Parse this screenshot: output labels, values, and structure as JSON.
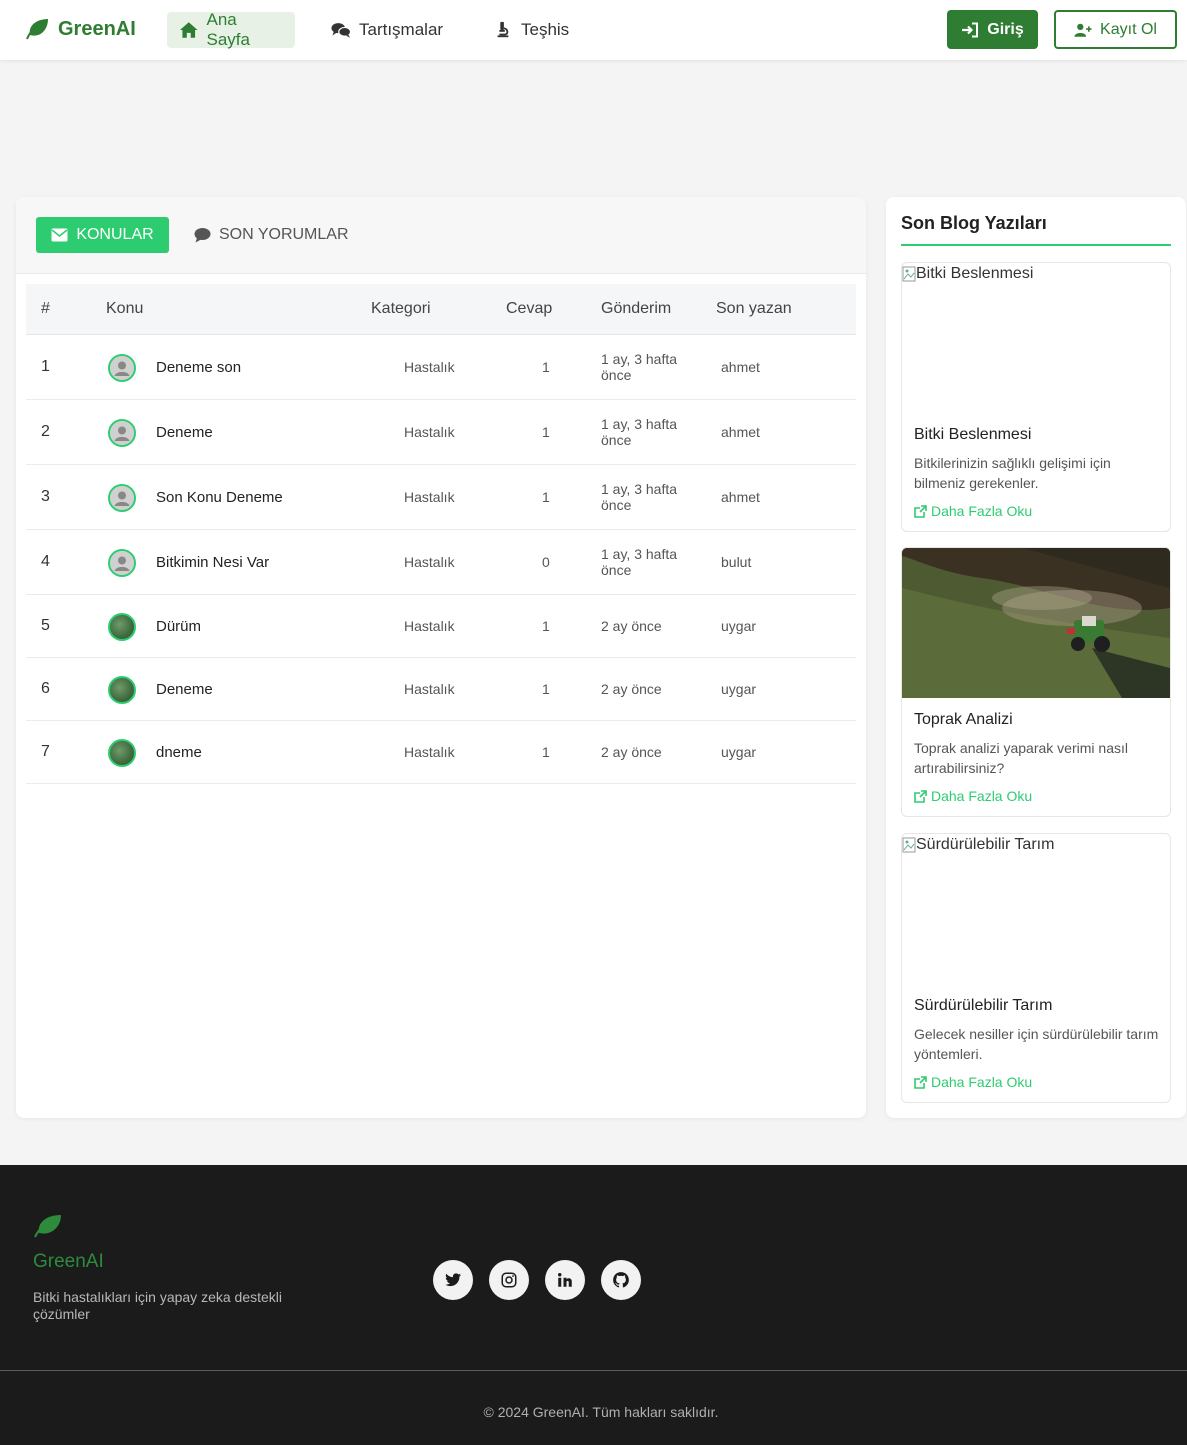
{
  "navbar": {
    "brand": "GreenAI",
    "items": [
      {
        "label": "Ana Sayfa",
        "icon": "home-icon",
        "active": true
      },
      {
        "label": "Tartışmalar",
        "icon": "comments-icon",
        "active": false
      },
      {
        "label": "Teşhis",
        "icon": "microscope-icon",
        "active": false
      }
    ],
    "login_label": "Giriş",
    "register_label": "Kayıt Ol"
  },
  "tabs": {
    "active_label": "KONULAR",
    "other_label": "SON YORUMLAR"
  },
  "table": {
    "headers": [
      "#",
      "Konu",
      "Kategori",
      "Cevap",
      "Gönderim",
      "Son yazan"
    ],
    "rows": [
      {
        "num": "1",
        "title": "Deneme son",
        "category": "Hastalık",
        "answers": "1",
        "date": "1 ay, 3 hafta önce",
        "author": "ahmet",
        "avatar": "default"
      },
      {
        "num": "2",
        "title": "Deneme",
        "category": "Hastalık",
        "answers": "1",
        "date": "1 ay, 3 hafta önce",
        "author": "ahmet",
        "avatar": "default"
      },
      {
        "num": "3",
        "title": "Son Konu Deneme",
        "category": "Hastalık",
        "answers": "1",
        "date": "1 ay, 3 hafta önce",
        "author": "ahmet",
        "avatar": "default"
      },
      {
        "num": "4",
        "title": "Bitkimin Nesi Var",
        "category": "Hastalık",
        "answers": "0",
        "date": "1 ay, 3 hafta önce",
        "author": "bulut",
        "avatar": "default"
      },
      {
        "num": "5",
        "title": "Dürüm",
        "category": "Hastalık",
        "answers": "1",
        "date": "2 ay önce",
        "author": "uygar",
        "avatar": "plant"
      },
      {
        "num": "6",
        "title": "Deneme",
        "category": "Hastalık",
        "answers": "1",
        "date": "2 ay önce",
        "author": "uygar",
        "avatar": "plant"
      },
      {
        "num": "7",
        "title": "dneme",
        "category": "Hastalık",
        "answers": "1",
        "date": "2 ay önce",
        "author": "uygar",
        "avatar": "plant"
      }
    ]
  },
  "sidebar": {
    "title": "Son Blog Yazıları",
    "posts": [
      {
        "image_alt": "Bitki Beslenmesi",
        "title": "Bitki Beslenmesi",
        "description": "Bitkilerinizin sağlıklı gelişimi için bilmeniz gerekenler.",
        "link": "Daha Fazla Oku"
      },
      {
        "image_alt": "Toprak Analizi",
        "title": "Toprak Analizi",
        "description": "Toprak analizi yaparak verimi nasıl artırabilirsiniz?",
        "link": "Daha Fazla Oku"
      },
      {
        "image_alt": "Sürdürülebilir Tarım",
        "title": "Sürdürülebilir Tarım",
        "description": "Gelecek nesiller için sürdürülebilir tarım yöntemleri.",
        "link": "Daha Fazla Oku"
      }
    ]
  },
  "footer": {
    "brand": "GreenAI",
    "description": "Bitki hastalıkları için yapay zeka destekli çözümler",
    "social": [
      "twitter-icon",
      "instagram-icon",
      "linkedin-icon",
      "github-icon"
    ],
    "copyright": "© 2024 GreenAI. Tüm hakları saklıdır."
  },
  "colors": {
    "brand_green": "#2e7d32",
    "accent_green": "#2ecc71",
    "footer_bg": "#1b1b1b"
  }
}
